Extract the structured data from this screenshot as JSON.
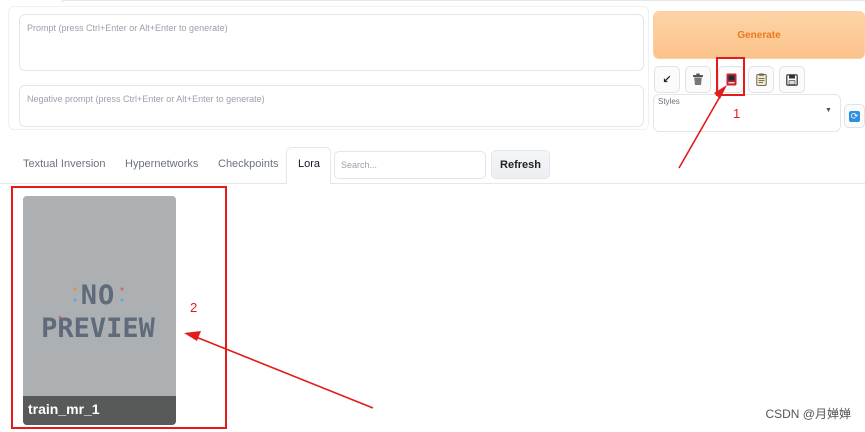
{
  "prompt": {
    "placeholder": "Prompt (press Ctrl+Enter or Alt+Enter to generate)",
    "value": ""
  },
  "negative_prompt": {
    "placeholder": "Negative prompt (press Ctrl+Enter or Alt+Enter to generate)",
    "value": ""
  },
  "generate": {
    "label": "Generate",
    "color": "#ea7a1d"
  },
  "toolbar": {
    "buttons": [
      {
        "icon": "arrow-down-left-icon",
        "glyph": "↙"
      },
      {
        "icon": "trash-icon"
      },
      {
        "icon": "show-extra-networks-icon"
      },
      {
        "icon": "clipboard-icon"
      },
      {
        "icon": "save-icon"
      }
    ]
  },
  "styles": {
    "label": "Styles",
    "selected": ""
  },
  "extra_networks": {
    "tabs": [
      {
        "label": "Textual Inversion",
        "active": false
      },
      {
        "label": "Hypernetworks",
        "active": false
      },
      {
        "label": "Checkpoints",
        "active": false
      },
      {
        "label": "Lora",
        "active": true
      }
    ],
    "search": {
      "placeholder": "Search...",
      "value": ""
    },
    "refresh_label": "Refresh",
    "cards": [
      {
        "name": "train_mr_1",
        "preview_text": [
          "NO",
          "PREVIEW"
        ]
      }
    ]
  },
  "annotations": {
    "color": "#e21b1b",
    "labels": [
      "1",
      "2"
    ]
  },
  "watermark": "CSDN @月婵婵"
}
